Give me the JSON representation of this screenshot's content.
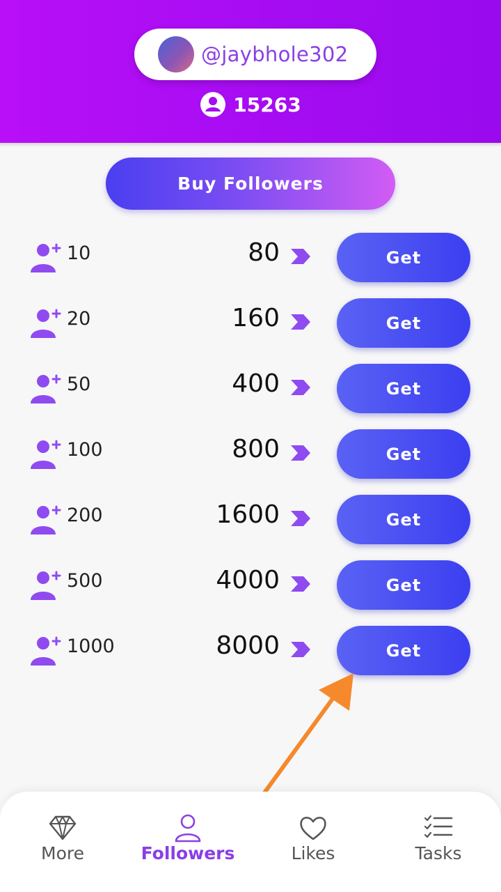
{
  "header": {
    "username": "@jaybhole302",
    "coins": "15263"
  },
  "buy_button_label": "Buy Followers",
  "packages": [
    {
      "followers": "10",
      "price": "80",
      "action": "Get"
    },
    {
      "followers": "20",
      "price": "160",
      "action": "Get"
    },
    {
      "followers": "50",
      "price": "400",
      "action": "Get"
    },
    {
      "followers": "100",
      "price": "800",
      "action": "Get"
    },
    {
      "followers": "200",
      "price": "1600",
      "action": "Get"
    },
    {
      "followers": "500",
      "price": "4000",
      "action": "Get"
    },
    {
      "followers": "1000",
      "price": "8000",
      "action": "Get"
    }
  ],
  "nav": [
    {
      "label": "More",
      "icon": "diamond-icon",
      "active": false
    },
    {
      "label": "Followers",
      "icon": "person-icon",
      "active": true
    },
    {
      "label": "Likes",
      "icon": "heart-icon",
      "active": false
    },
    {
      "label": "Tasks",
      "icon": "checklist-icon",
      "active": false
    }
  ],
  "colors": {
    "header": "#a40cf2",
    "accent": "#8a3fe6",
    "get_button": "#3c3ff0",
    "arrow": "#f5892b"
  }
}
